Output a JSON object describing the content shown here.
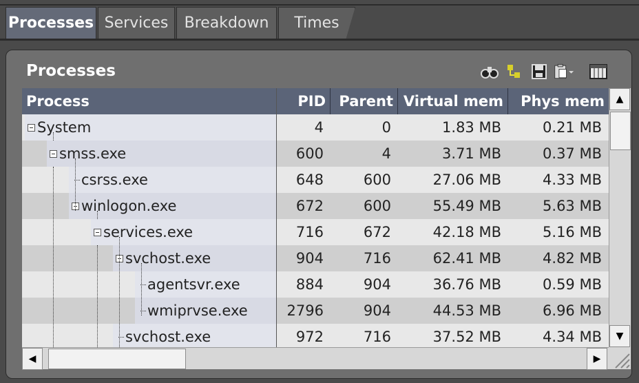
{
  "tabs": [
    {
      "label": "Processes",
      "active": true
    },
    {
      "label": "Services",
      "active": false
    },
    {
      "label": "Breakdown",
      "active": false
    },
    {
      "label": "Times",
      "active": false
    }
  ],
  "panel": {
    "title": "Processes"
  },
  "toolbar_icons": [
    "binoculars-icon",
    "tree-icon",
    "save-icon",
    "clipboard-icon",
    "columns-icon"
  ],
  "columns": [
    "Process",
    "PID",
    "Parent",
    "Virtual mem",
    "Phys mem"
  ],
  "rows": [
    {
      "process": "System",
      "pid": "4",
      "parent": "0",
      "virtual": "1.83 MB",
      "phys": "0.21 MB",
      "depth": 0,
      "expander": true
    },
    {
      "process": "smss.exe",
      "pid": "600",
      "parent": "4",
      "virtual": "3.71 MB",
      "phys": "0.37 MB",
      "depth": 1,
      "expander": true
    },
    {
      "process": "csrss.exe",
      "pid": "648",
      "parent": "600",
      "virtual": "27.06 MB",
      "phys": "4.33 MB",
      "depth": 2,
      "expander": false
    },
    {
      "process": "winlogon.exe",
      "pid": "672",
      "parent": "600",
      "virtual": "55.49 MB",
      "phys": "5.63 MB",
      "depth": 2,
      "expander": true
    },
    {
      "process": "services.exe",
      "pid": "716",
      "parent": "672",
      "virtual": "42.18 MB",
      "phys": "5.16 MB",
      "depth": 3,
      "expander": true
    },
    {
      "process": "svchost.exe",
      "pid": "904",
      "parent": "716",
      "virtual": "62.41 MB",
      "phys": "4.82 MB",
      "depth": 4,
      "expander": true
    },
    {
      "process": "agentsvr.exe",
      "pid": "884",
      "parent": "904",
      "virtual": "36.76 MB",
      "phys": "0.59 MB",
      "depth": 5,
      "expander": false
    },
    {
      "process": "wmiprvse.exe",
      "pid": "2796",
      "parent": "904",
      "virtual": "44.53 MB",
      "phys": "6.96 MB",
      "depth": 5,
      "expander": false
    },
    {
      "process": "svchost.exe",
      "pid": "972",
      "parent": "716",
      "virtual": "37.52 MB",
      "phys": "4.34 MB",
      "depth": 4,
      "expander": false
    }
  ],
  "colors": {
    "header": "#5b6478",
    "row_light": "#e8e8e8",
    "row_dark": "#cfcfcf",
    "name_bg": "#dde0ec"
  }
}
